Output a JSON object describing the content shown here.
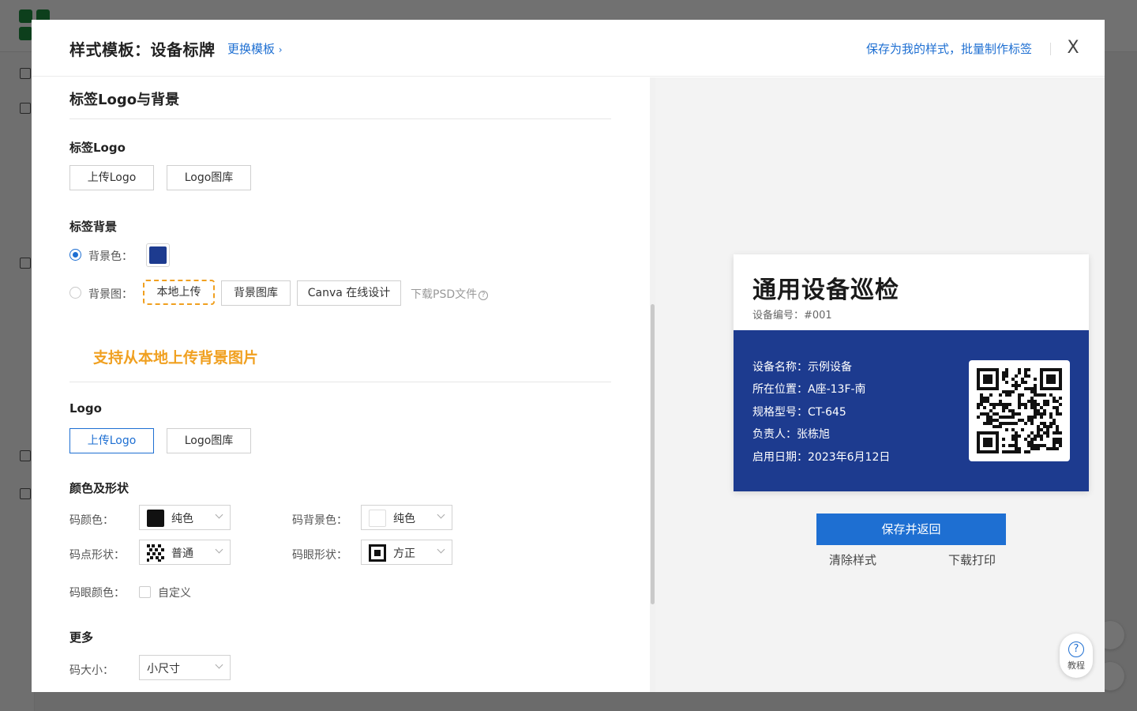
{
  "modal": {
    "title": "样式模板：设备标牌",
    "switch_template": "更换模板",
    "save_as_my_style": "保存为我的样式，批量制作标签",
    "close": "X"
  },
  "sections": {
    "logo_bg_title": "标签Logo与背景",
    "label_logo_title": "标签Logo",
    "upload_logo": "上传Logo",
    "logo_library": "Logo图库",
    "label_bg_title": "标签背景",
    "bg_color_label": "背景色：",
    "bg_color": "#1d3b8f",
    "bg_image_label": "背景图：",
    "local_upload": "本地上传",
    "bg_library": "背景图库",
    "canva_design": "Canva 在线设计",
    "download_psd": "下载PSD文件",
    "tooltip": "支持从本地上传背景图片",
    "logo_title": "Logo",
    "logo_upload": "上传Logo",
    "logo_library2": "Logo图库",
    "color_shape_title": "颜色及形状",
    "code_color_label": "码颜色：",
    "code_color_value": "纯色",
    "code_bg_color_label": "码背景色：",
    "code_bg_color_value": "纯色",
    "dot_shape_label": "码点形状：",
    "dot_shape_value": "普通",
    "eye_shape_label": "码眼形状：",
    "eye_shape_value": "方正",
    "eye_color_label": "码眼颜色：",
    "eye_color_custom": "自定义",
    "more_title": "更多",
    "code_size_label": "码大小：",
    "code_size_value": "小尺寸"
  },
  "preview": {
    "title": "通用设备巡检",
    "code": "设备编号：#001",
    "lines": [
      "设备名称：示例设备",
      "所在位置：A座-13F-南",
      "规格型号：CT-645",
      "负责人：张栋旭",
      "启用日期：2023年6月12日"
    ],
    "save_return": "保存并返回",
    "clear_style": "清除样式",
    "download_print": "下载打印"
  },
  "help": {
    "icon": "?",
    "label": "教程"
  },
  "colors": {
    "accent": "#1e6fd2",
    "label_blue": "#1d3b8f",
    "tooltip_orange": "#f0a020"
  }
}
